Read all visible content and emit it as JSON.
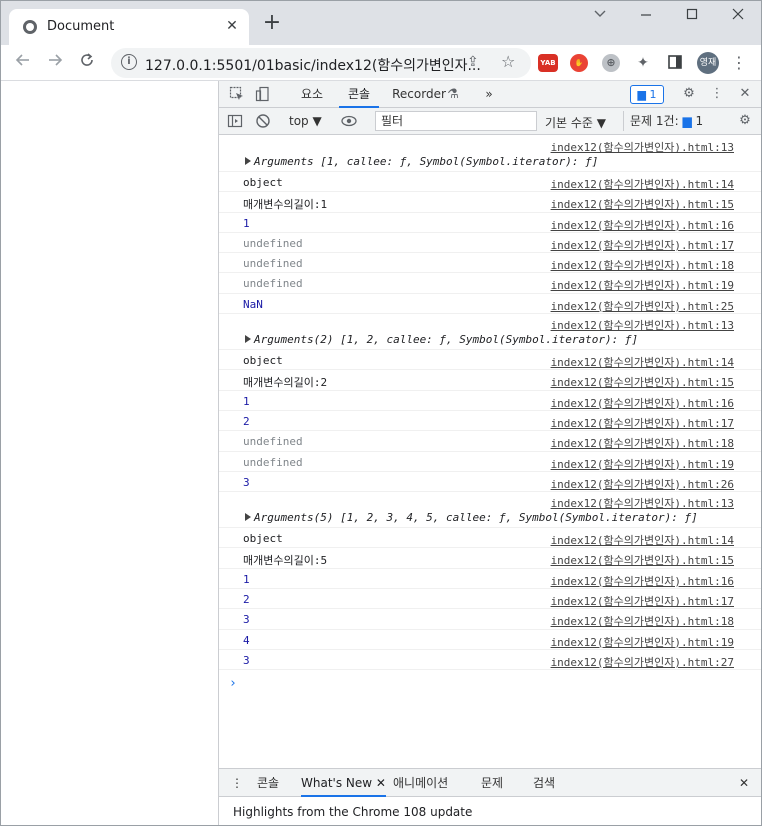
{
  "browser": {
    "tab_title": "Document",
    "new_tab": "+",
    "url": "127.0.0.1:5501/01basic/index12(함수의가변인자...",
    "avatar_text": "영재",
    "window_controls": [
      "‒",
      "☐",
      "✕"
    ]
  },
  "devtools": {
    "tabs": [
      "요소",
      "콘솔",
      "Recorder",
      "»"
    ],
    "active_tab": "콘솔",
    "issues_count": "1",
    "context": "top",
    "filter_placeholder": "필터",
    "levels": "기본 수준",
    "issues_label": "문제 1건:",
    "issues_badge": "1",
    "console_rows": [
      {
        "type": "args",
        "msg": "Arguments [1, callee: ƒ, Symbol(Symbol.iterator): ƒ]",
        "src": "index12(함수의가변인자).html:13"
      },
      {
        "type": "text",
        "msg": "object",
        "src": "index12(함수의가변인자).html:14"
      },
      {
        "type": "text",
        "msg": "매개변수의길이:1",
        "src": "index12(함수의가변인자).html:15"
      },
      {
        "type": "num",
        "msg": "1",
        "src": "index12(함수의가변인자).html:16"
      },
      {
        "type": "undef",
        "msg": "undefined",
        "src": "index12(함수의가변인자).html:17"
      },
      {
        "type": "undef",
        "msg": "undefined",
        "src": "index12(함수의가변인자).html:18"
      },
      {
        "type": "undef",
        "msg": "undefined",
        "src": "index12(함수의가변인자).html:19"
      },
      {
        "type": "num",
        "msg": "NaN",
        "src": "index12(함수의가변인자).html:25"
      },
      {
        "type": "args",
        "msg": "Arguments(2) [1, 2, callee: ƒ, Symbol(Symbol.iterator): ƒ]",
        "src": "index12(함수의가변인자).html:13"
      },
      {
        "type": "text",
        "msg": "object",
        "src": "index12(함수의가변인자).html:14"
      },
      {
        "type": "text",
        "msg": "매개변수의길이:2",
        "src": "index12(함수의가변인자).html:15"
      },
      {
        "type": "num",
        "msg": "1",
        "src": "index12(함수의가변인자).html:16"
      },
      {
        "type": "num",
        "msg": "2",
        "src": "index12(함수의가변인자).html:17"
      },
      {
        "type": "undef",
        "msg": "undefined",
        "src": "index12(함수의가변인자).html:18"
      },
      {
        "type": "undef",
        "msg": "undefined",
        "src": "index12(함수의가변인자).html:19"
      },
      {
        "type": "num",
        "msg": "3",
        "src": "index12(함수의가변인자).html:26"
      },
      {
        "type": "args",
        "msg": "Arguments(5) [1, 2, 3, 4, 5, callee: ƒ, Symbol(Symbol.iterator): ƒ]",
        "src": "index12(함수의가변인자).html:13"
      },
      {
        "type": "text",
        "msg": "object",
        "src": "index12(함수의가변인자).html:14"
      },
      {
        "type": "text",
        "msg": "매개변수의길이:5",
        "src": "index12(함수의가변인자).html:15"
      },
      {
        "type": "num",
        "msg": "1",
        "src": "index12(함수의가변인자).html:16"
      },
      {
        "type": "num",
        "msg": "2",
        "src": "index12(함수의가변인자).html:17"
      },
      {
        "type": "num",
        "msg": "3",
        "src": "index12(함수의가변인자).html:18"
      },
      {
        "type": "num",
        "msg": "4",
        "src": "index12(함수의가변인자).html:19"
      },
      {
        "type": "num",
        "msg": "3",
        "src": "index12(함수의가변인자).html:27"
      }
    ],
    "prompt": "›",
    "drawer": {
      "tabs": [
        "콘솔",
        "What's New",
        "애니메이션",
        "문제",
        "검색"
      ],
      "active_tab": "What's New",
      "content": "Highlights from the Chrome 108 update"
    }
  },
  "icons": {
    "back": "arrow-left-icon",
    "forward": "arrow-right-icon",
    "reload": "reload-icon",
    "info": "info-icon",
    "share": "share-icon",
    "star": "star-icon",
    "extensions": "puzzle-icon",
    "sidepanel": "sidepanel-icon",
    "menu": "kebab-menu-icon"
  },
  "colors": {
    "accent": "#1a73e8",
    "number": "#1a1aa6",
    "undefined": "#80868b"
  }
}
